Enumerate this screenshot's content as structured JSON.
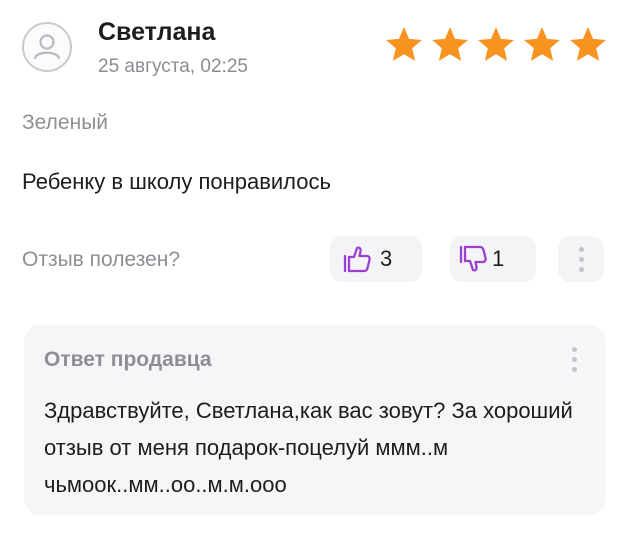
{
  "review": {
    "author_name": "Светлана",
    "date": "25 августа, 02:25",
    "rating": 5,
    "rating_max": 5,
    "variant": "Зеленый",
    "text": "Ребенку в школу понравилось"
  },
  "helpful": {
    "question": "Отзыв полезен?",
    "likes": "3",
    "dislikes": "1"
  },
  "seller_answer": {
    "title": "Ответ продавца",
    "text": "Здравствуйте, Светлана,как вас зовут? За хороший отзыв от меня подарок-поцелуй ммм..м чьмоок..мм..оо..м.м.ооо"
  },
  "colors": {
    "star": "#f7931e",
    "secondary_text": "#8e8e95",
    "button_bg": "#f4f4f7",
    "answer_bg": "#f6f6f9",
    "icon_stroke": "#9b3fcf"
  },
  "icons": {
    "avatar": "user-avatar-icon",
    "like": "thumbs-up-icon",
    "dislike": "thumbs-down-icon",
    "more": "vertical-dots-icon",
    "star": "star-icon"
  }
}
